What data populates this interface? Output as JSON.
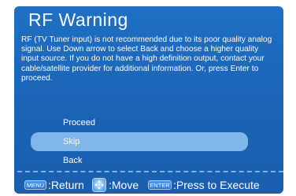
{
  "dialog": {
    "title": "RF Warning",
    "message": "RF (TV Tuner input) is not recommended due to its poor quality analog signal. Use Down arrow to select Back and choose a higher quality input source. If you do not have a high definition output, contact your cable/satellite provider for additional information. Or, press Enter to proceed."
  },
  "options": [
    {
      "label": "Proceed",
      "selected": false
    },
    {
      "label": "Skip",
      "selected": true
    },
    {
      "label": "Back",
      "selected": false
    }
  ],
  "footer": {
    "menu_key": "MENU",
    "menu_action": ":Return",
    "move_icon": "dpad-icon",
    "move_action": ":Move",
    "enter_key": "ENTER",
    "enter_action": ":Press to Execute"
  },
  "colors": {
    "background": "#1b63b6",
    "highlight": "#7fb7ea",
    "text": "#ffffff"
  }
}
